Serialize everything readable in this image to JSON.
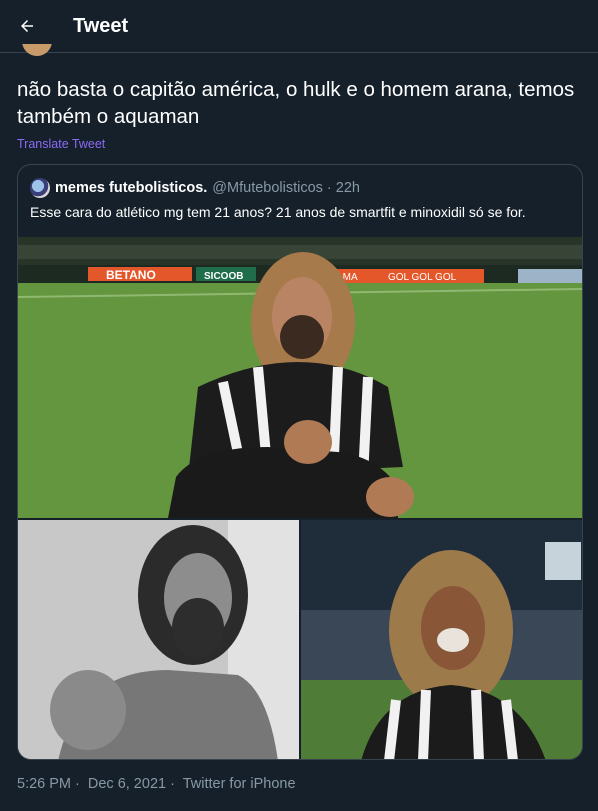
{
  "header": {
    "title": "Tweet",
    "back_icon": "arrow-left-icon"
  },
  "tweet": {
    "text": "não basta o capitão américa, o hulk e o homem arana, temos também o aquaman",
    "translate_label": "Translate Tweet",
    "time": "5:26 PM",
    "date": "Dec 6, 2021",
    "source": "Twitter for iPhone"
  },
  "quote": {
    "author_name": "memes futebolisticos.",
    "author_handle": "@Mfutebolisticos",
    "separator": "·",
    "time": "22h",
    "text": "Esse cara do atlético mg tem 21 anos? 21 anos de smartfit  e minoxidil só se for."
  },
  "media": {
    "ad_boards": [
      "BETANO",
      "SICOOB",
      "AMA",
      "GOL GOL GOL"
    ]
  },
  "colors": {
    "background": "#15202b",
    "border": "#38444d",
    "secondary_text": "#8899a6",
    "link": "#8b6bf5"
  }
}
